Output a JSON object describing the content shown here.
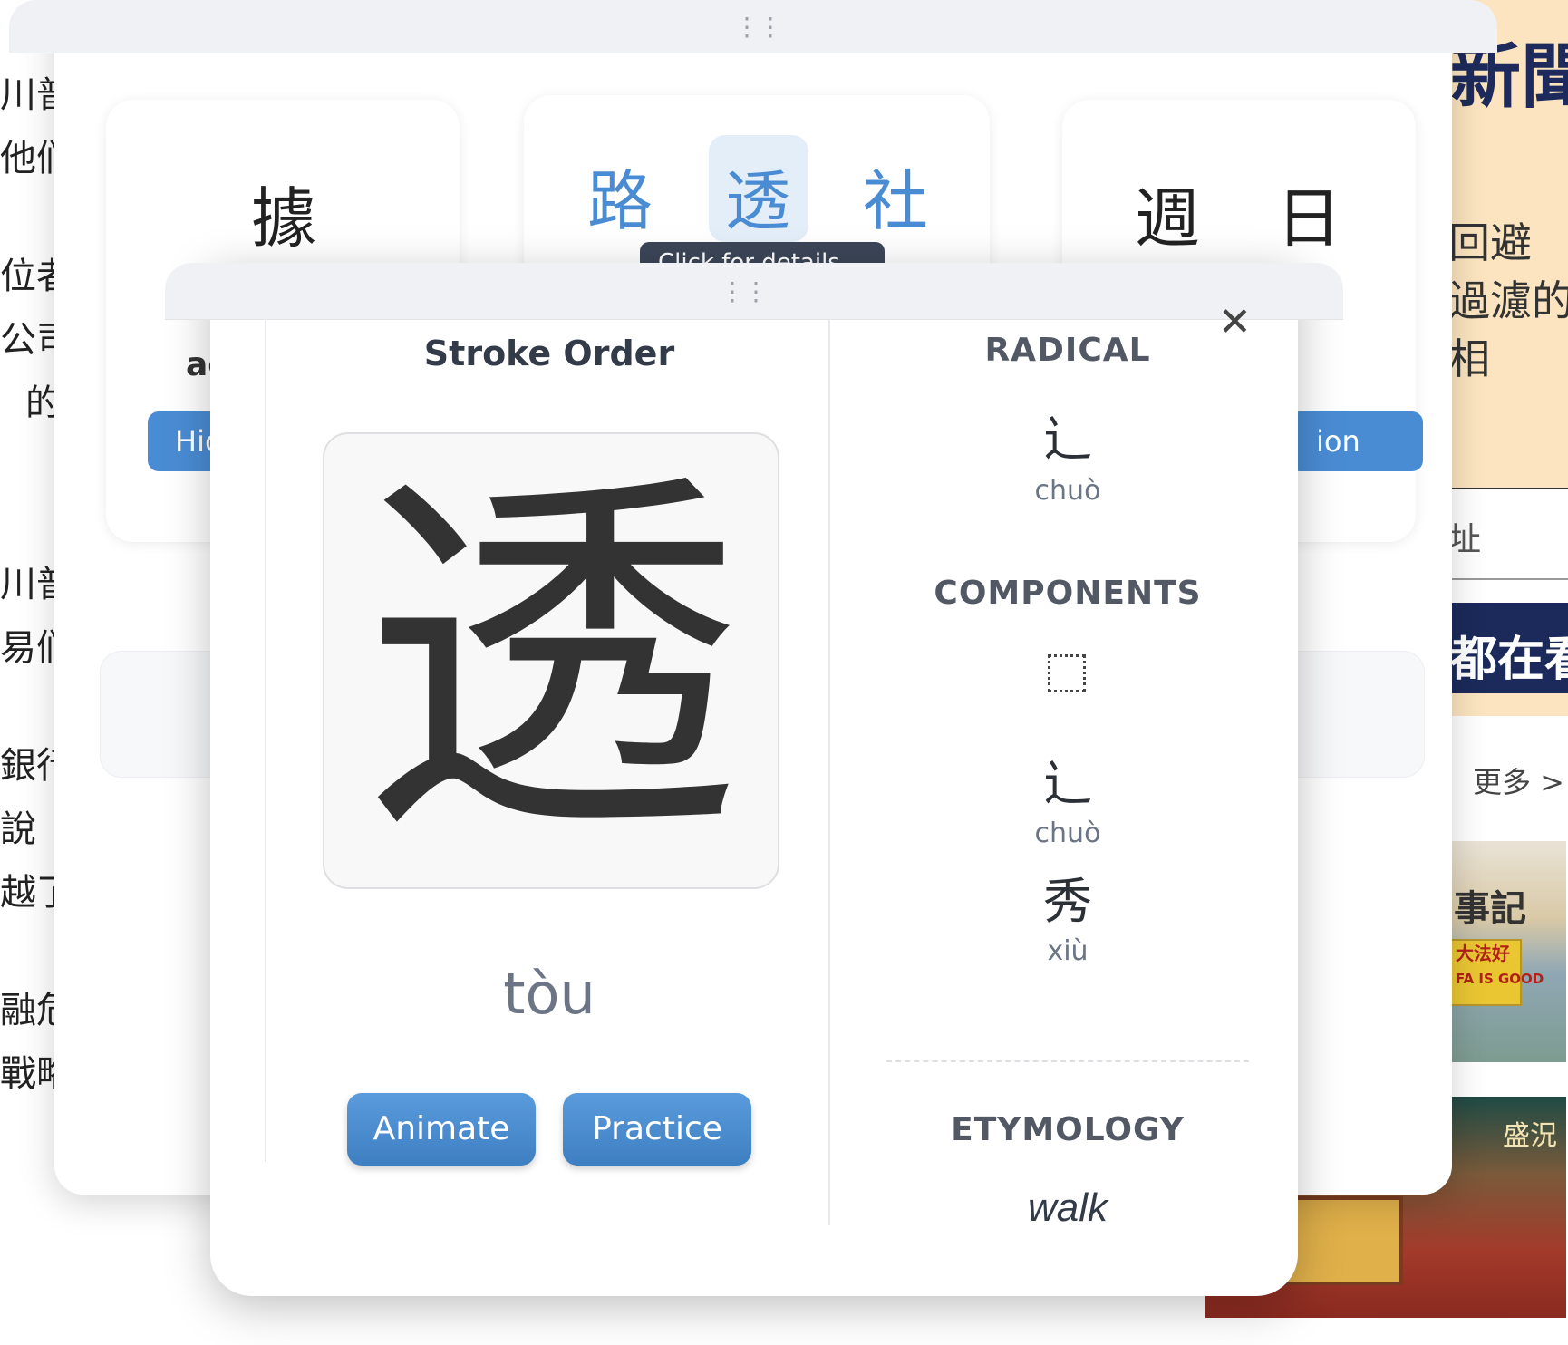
{
  "background": {
    "left_column_fragments": [
      "川普",
      "他们",
      "位者",
      "公司",
      "的",
      "川普",
      "易们",
      "銀行",
      "說",
      "越了",
      "融危",
      "戰略"
    ],
    "right_headline": "新聞",
    "right_lines": [
      "回避",
      "過濾的",
      "相"
    ],
    "right_address": "址",
    "right_banner": "都在看",
    "more_link": "更多 >",
    "image1_title": "事記",
    "image1_banner_lines": [
      "大法好",
      "FA IS GOOD"
    ],
    "image2_title": "盛況"
  },
  "back_window": {
    "card_left": {
      "char": "據",
      "text": "ac",
      "button": "Hid"
    },
    "card_center": {
      "chars": [
        "路",
        "透",
        "社"
      ],
      "tooltip": "Click for details"
    },
    "card_right": {
      "chars": [
        "週",
        "日"
      ],
      "button": "ion"
    }
  },
  "modal": {
    "stroke_order_title": "Stroke Order",
    "character": "透",
    "pinyin": "tòu",
    "buttons": {
      "animate": "Animate",
      "practice": "Practice"
    },
    "radical": {
      "label": "RADICAL",
      "char": "辶",
      "pinyin": "chuò"
    },
    "components": {
      "label": "COMPONENTS",
      "items": [
        {
          "char": "辶",
          "pinyin": "chuò"
        },
        {
          "char": "秀",
          "pinyin": "xiù"
        }
      ]
    },
    "etymology": {
      "label": "ETYMOLOGY",
      "text": "walk"
    },
    "close_symbol": "✕",
    "drag_handle": "⋮⋮"
  },
  "colors": {
    "accent_blue": "#4a8cd4",
    "highlight_bg": "#e3eef9",
    "tooltip_bg": "#3c4658",
    "panel_beige": "#fbe4bf",
    "navy": "#1b2a5a"
  },
  "icons": {
    "close": "close-icon",
    "drag": "drag-handle-icon",
    "component_placeholder": "component-placeholder-icon"
  }
}
